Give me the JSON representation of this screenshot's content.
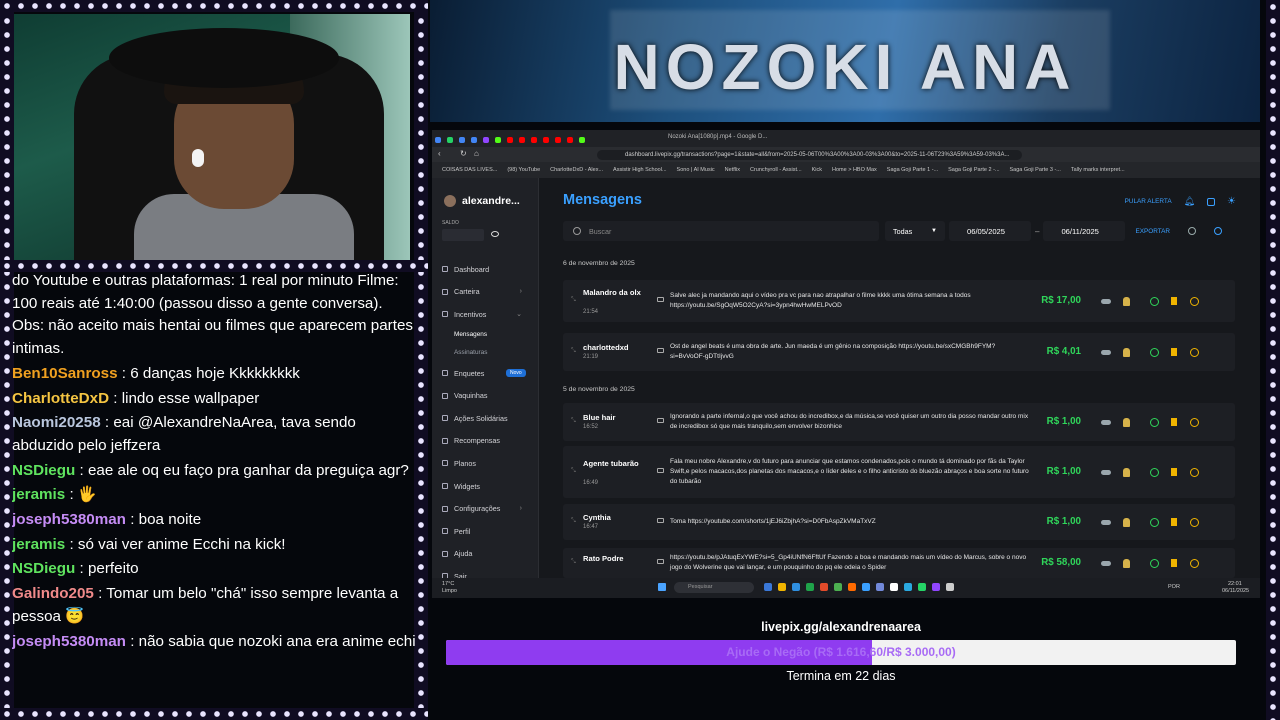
{
  "chat": [
    {
      "user": "",
      "color": "#ffffff",
      "text": "do Youtube e outras plataformas: 1 real por minuto Filme: 100 reais até 1:40:00 (passou disso a gente conversa). Obs: não aceito mais hentai ou filmes que aparecem partes intimas."
    },
    {
      "user": "Ben10Sanross",
      "color": "#f0a020",
      "text": ": 6 danças hoje Kkkkkkkkk"
    },
    {
      "user": "CharlotteDxD",
      "color": "#f5c542",
      "text": ": lindo esse wallpaper"
    },
    {
      "user": "Naomi20258",
      "color": "#b9c6dd",
      "text": ": eai @AlexandreNaArea, tava sendo abduzido pelo jeffzera"
    },
    {
      "user": "NSDiegu",
      "color": "#5fe35f",
      "text": ": eae ale oq eu faço pra ganhar da preguiça agr?"
    },
    {
      "user": "jeramis",
      "color": "#5fe35f",
      "text": ": 🖐"
    },
    {
      "user": "joseph5380man",
      "color": "#c58cf5",
      "text": ": boa noite"
    },
    {
      "user": "jeramis",
      "color": "#5fe35f",
      "text": ": só vai ver anime Ecchi na kick!"
    },
    {
      "user": "NSDiegu",
      "color": "#5fe35f",
      "text": ": perfeito"
    },
    {
      "user": "Galindo205",
      "color": "#f08a8a",
      "text": ": Tomar um belo \"chá\" isso sempre levanta a pessoa 😇"
    },
    {
      "user": "joseph5380man",
      "color": "#c58cf5",
      "text": ": não sabia que nozoki ana era anime echi"
    }
  ],
  "banner": {
    "title": "NOZOKI ANA"
  },
  "browser": {
    "tab_title": "Nozoki Ana[1080p].mp4 - Google D...",
    "url": "dashboard.livepix.gg/transactions?page=1&state=all&from=2025-05-06T00%3A00%3A00-03%3A00&to=2025-11-06T23%3A59%3A59-03%3A...",
    "bookmarks": [
      "COISAS DAS LIVES...",
      "(98) YouTube",
      "CharlotteDxD - Alex...",
      "Assistir High School...",
      "Sono | AI Music",
      "Netflix",
      "Crunchyroll - Assist...",
      "Kick",
      "Home > HBO Max",
      "Saga Goji Parte 1 -...",
      "Saga Goji Parte 2 -...",
      "Saga Goji Parte 3 -...",
      "Tally marks interpret..."
    ]
  },
  "sidebar": {
    "username": "alexandre...",
    "saldo_label": "SALDO",
    "items": [
      {
        "label": "Dashboard"
      },
      {
        "label": "Carteira",
        "caret": "›"
      },
      {
        "label": "Incentivos",
        "caret": "⌄"
      },
      {
        "label": "Mensagens",
        "sub": true,
        "active": true
      },
      {
        "label": "Assinaturas",
        "sub": true
      },
      {
        "label": "Enquetes",
        "badge": "Novo"
      },
      {
        "label": "Vaquinhas"
      },
      {
        "label": "Ações Solidárias"
      },
      {
        "label": "Recompensas"
      },
      {
        "label": "Planos"
      },
      {
        "label": "Widgets"
      },
      {
        "label": "Configurações",
        "caret": "›"
      },
      {
        "label": "Perfil"
      },
      {
        "label": "Ajuda"
      },
      {
        "label": "Sair"
      }
    ]
  },
  "main": {
    "title": "Mensagens",
    "pular_alerta": "PULAR ALERTA",
    "search_placeholder": "Buscar",
    "filter": "Todas",
    "date_from": "06/05/2025",
    "date_to": "06/11/2025",
    "export": "EXPORTAR",
    "date_headers": [
      "6 de novembro de 2025",
      "5 de novembro de 2025"
    ],
    "messages": [
      {
        "name": "Malandro da olx",
        "time": "21:54",
        "text": "Salve alec ja mandando aqui o vídeo pra vc para nao atrapalhar o filme kkkk uma ótima semana a todos https://youtu.be/SgOqW5O2CyA?si=3ypn4hwHwMELPvOD",
        "amount": "R$ 17,00"
      },
      {
        "name": "charlottedxd",
        "time": "21:19",
        "text": "Ost de angel beats é uma obra de arte. Jun maeda é um gênio na composição https://youtu.be/sxCMGBh9FYM?si=BvVoOF-gDTtIjvvG",
        "amount": "R$ 4,01"
      },
      {
        "name": "Blue hair",
        "time": "16:52",
        "text": "Ignorando a parte infernal,o que você achou do incredibox,e da música,se você quiser um outro dia posso mandar outro mix de incredibox só que mais tranquilo,sem envolver bizonhice",
        "amount": "R$ 1,00"
      },
      {
        "name": "Agente tubarão",
        "time": "16:49",
        "text": "Fala meu nobre Alexandre,v do futuro para anunciar que estamos condenados,pois o mundo tá dominado por fãs da Taylor Swift,e pelos macacos,dos planetas dos macacos,e o líder deles e o filho anticristo do bluezão abraços e boa sorte no futuro do tubarão",
        "amount": "R$ 1,00"
      },
      {
        "name": "Cynthia",
        "time": "16:47",
        "text": "Toma https://youtube.com/shorts/1jEJ6iZbjhA?si=D0FbAspZkVMaTxVZ",
        "amount": "R$ 1,00"
      },
      {
        "name": "Rato Podre",
        "time": "",
        "text": "https://youtu.be/pJAtuqExYWE?si=5_Gp4iUNfN6FftUf Fazendo a boa e mandando mais um vídeo do Marcus, sobre o novo jogo do Wolverine que vai lançar, e um pouquinho do pq ele odeia o Spider",
        "amount": "R$ 58,00"
      }
    ]
  },
  "taskbar": {
    "weather": "17°C",
    "weather_sub": "Limpo",
    "search": "Pesquisar",
    "lang": "POR",
    "time": "22:01",
    "date": "06/11/2025"
  },
  "goal": {
    "url": "livepix.gg/alexandrenaarea",
    "label": "Ajude o Negão (R$ 1.616,60/R$ 3.000,00)",
    "progress": 0.539,
    "ends": "Termina em 22 dias"
  }
}
